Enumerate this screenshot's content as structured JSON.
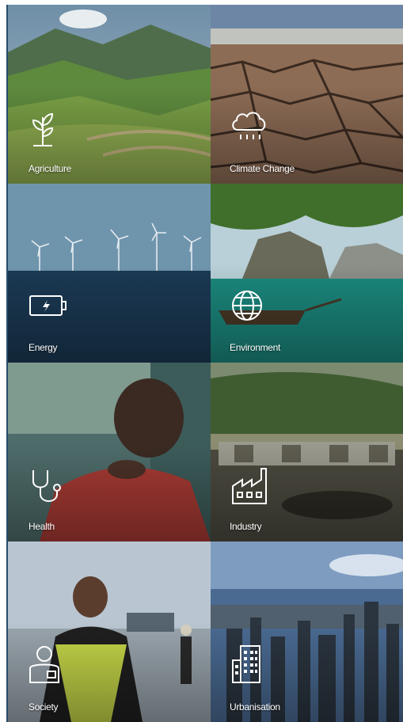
{
  "tiles": [
    {
      "label": "Agriculture",
      "icon": "plant-icon"
    },
    {
      "label": "Climate Change",
      "icon": "cloud-rain-icon"
    },
    {
      "label": "Energy",
      "icon": "battery-charging-icon"
    },
    {
      "label": "Environment",
      "icon": "globe-icon"
    },
    {
      "label": "Health",
      "icon": "stethoscope-icon"
    },
    {
      "label": "Industry",
      "icon": "factory-icon"
    },
    {
      "label": "Society",
      "icon": "person-icon"
    },
    {
      "label": "Urbanisation",
      "icon": "building-icon"
    }
  ]
}
